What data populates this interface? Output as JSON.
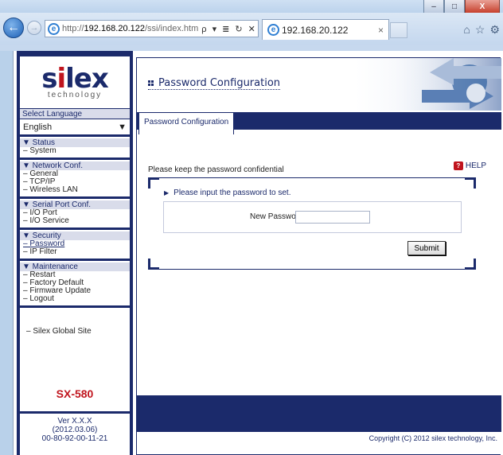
{
  "browser": {
    "url_prefix": "http://",
    "url_host": "192.168.20.122",
    "url_path": "/ssi/index.htm",
    "addr_tools": "ρ ▾ ≣ ↻ ✕",
    "tab_title": "192.168.20.122",
    "tab_close": "×",
    "window_min": "–",
    "window_max": "□",
    "window_close": "X"
  },
  "sidebar": {
    "logo_main_a": "s",
    "logo_main_i": "i",
    "logo_main_b": "lex",
    "logo_sub": "technology",
    "language_label": "Select Language",
    "language_value": "English",
    "sections": [
      {
        "head": "▼ Status",
        "items": [
          "– System"
        ]
      },
      {
        "head": "▼ Network Conf.",
        "items": [
          "– General",
          "– TCP/IP",
          "– Wireless LAN"
        ]
      },
      {
        "head": "▼ Serial Port Conf.",
        "items": [
          "– I/O Port",
          "– I/O Service"
        ]
      },
      {
        "head": "▼ Security",
        "items": [
          "– Password",
          "– IP Filter"
        ]
      },
      {
        "head": "▼ Maintenance",
        "items": [
          "– Restart",
          "– Factory Default",
          "– Firmware Update",
          "– Logout"
        ]
      }
    ],
    "global_link": "– Silex Global Site",
    "model": "SX-580",
    "version": "Ver X.X.X",
    "version_date": "(2012.03.06)",
    "mac": "00-80-92-00-11-21"
  },
  "main": {
    "page_title": "Password Configuration",
    "tab_label": "Password Configuration",
    "note": "Please keep the password confidential",
    "help": "HELP",
    "instruction": "Please input the password to set.",
    "new_password_label": "New Password :",
    "new_password_value": "",
    "submit_label": "Submit",
    "copyright": "Copyright (C) 2012 silex technology, Inc."
  },
  "colors": {
    "navy": "#1b2a6b",
    "brand_red": "#c0141d"
  }
}
